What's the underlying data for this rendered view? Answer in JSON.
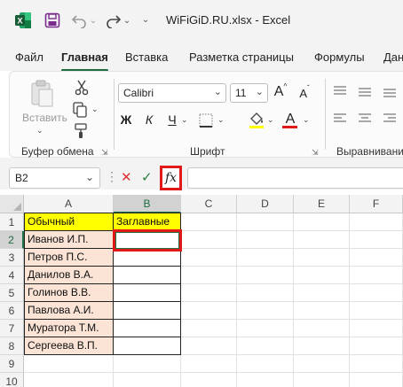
{
  "titlebar": {
    "quick_access_icons": [
      "excel-logo-icon",
      "save-icon",
      "undo-icon",
      "redo-icon"
    ],
    "document_title": "WiFiGiD.RU.xlsx  -  Excel"
  },
  "tabs": [
    {
      "label": "Файл",
      "active": false
    },
    {
      "label": "Главная",
      "active": true
    },
    {
      "label": "Вставка",
      "active": false
    },
    {
      "label": "Разметка страницы",
      "active": false
    },
    {
      "label": "Формулы",
      "active": false
    },
    {
      "label": "Дан",
      "active": false
    }
  ],
  "ribbon": {
    "clipboard": {
      "group_label": "Буфер обмена",
      "paste_label": "Вставить"
    },
    "font": {
      "group_label": "Шрифт",
      "font_name": "Calibri",
      "font_size": "11",
      "bold_label": "Ж",
      "italic_label": "К",
      "underline_label": "Ч",
      "grow_label": "A",
      "shrink_label": "A",
      "font_color_label": "A"
    },
    "alignment": {
      "group_label": "Выравнивани"
    }
  },
  "formula_bar": {
    "name_box": "B2",
    "fx_label": "fx",
    "formula": ""
  },
  "sheet": {
    "columns": [
      "A",
      "B",
      "C",
      "D",
      "E",
      "F"
    ],
    "selected_column": "B",
    "rows": [
      "1",
      "2",
      "3",
      "4",
      "5",
      "6",
      "7",
      "8",
      "9",
      "10"
    ],
    "selected_row": "2",
    "cells": {
      "A1": "Обычный",
      "B1": "Заглавные",
      "A2": "Иванов И.П.",
      "A3": "Петров П.С.",
      "A4": "Данилов В.А.",
      "A5": "Голинов В.В.",
      "A6": "Павлова А.И.",
      "A7": "Муратора Т.М.",
      "A8": "Сергеева В.П."
    },
    "colors": {
      "header_fill": "#ffff00",
      "name_fill": "#fbe3d6",
      "highlight_border": "#e01818",
      "excel_green": "#217346"
    }
  }
}
